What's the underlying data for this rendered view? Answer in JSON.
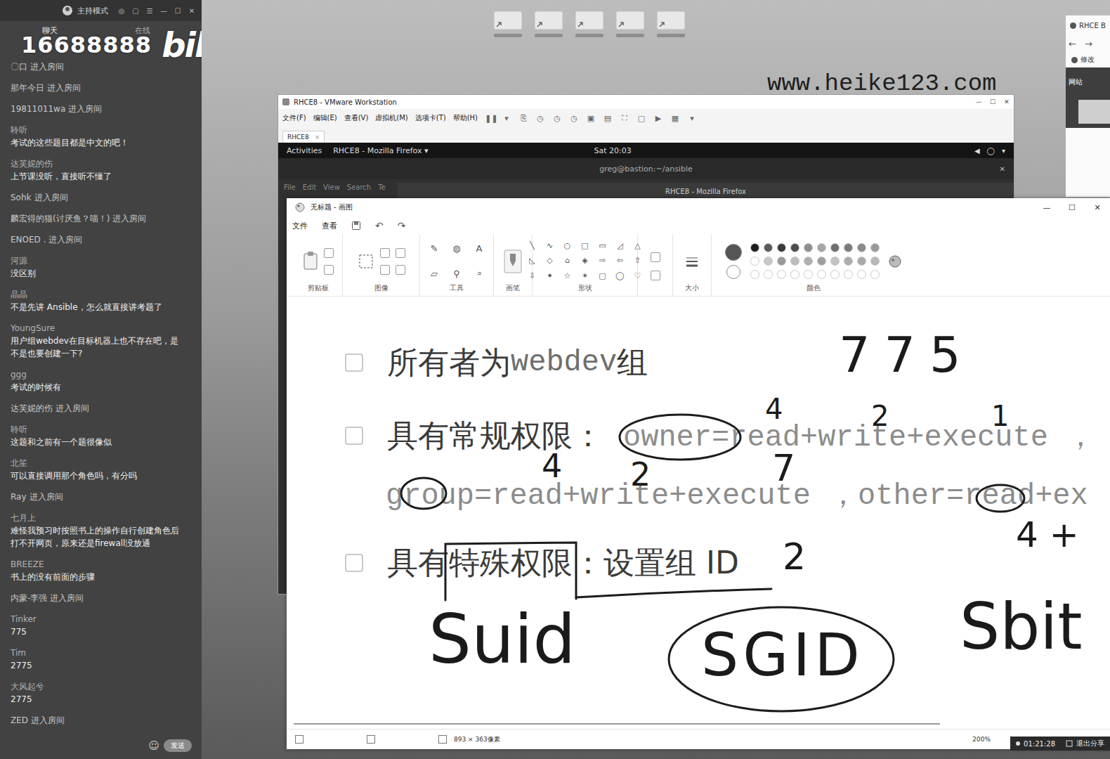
{
  "live_panel": {
    "mode": "主持模式",
    "controls": [
      "◎",
      "▢",
      "☰",
      "—",
      "☐",
      "✕"
    ],
    "tabs": [
      {
        "label": "聊天",
        "selected": true
      },
      {
        "label": "在线",
        "selected": false
      }
    ],
    "messages": [
      {
        "kind": "enter",
        "user": "〇口",
        "text": "进入房间"
      },
      {
        "kind": "enter",
        "user": "那年今日",
        "text": "进入房间"
      },
      {
        "kind": "enter",
        "user": "19811011wa",
        "text": "进入房间"
      },
      {
        "kind": "chat",
        "user": "聆听",
        "text": "考试的这些题目都是中文的吧！"
      },
      {
        "kind": "chat",
        "user": "达芙妮的伤",
        "text": "上节课没听，直接听不懂了"
      },
      {
        "kind": "enter",
        "user": "Sohk",
        "text": "进入房间"
      },
      {
        "kind": "enter",
        "user": "麟宏得的猫(讨厌鱼？喵！)",
        "text": "进入房间"
      },
      {
        "kind": "enter",
        "user": "ENOED .",
        "text": "进入房间"
      },
      {
        "kind": "chat",
        "user": "河源",
        "text": "没区别"
      },
      {
        "kind": "chat",
        "user": "晶晶",
        "text": "不是先讲 Ansible，怎么就直接讲考题了"
      },
      {
        "kind": "chat",
        "user": "YoungSure",
        "text": "用户组webdev在目标机器上也不存在吧，是不是也要创建一下?"
      },
      {
        "kind": "chat",
        "user": "ggg",
        "text": "考试的时候有"
      },
      {
        "kind": "enter",
        "user": "达芙妮的伤",
        "text": "进入房间"
      },
      {
        "kind": "chat",
        "user": "聆听",
        "text": "这题和之前有一个题很像似"
      },
      {
        "kind": "chat",
        "user": "北笙",
        "text": "可以直接调用那个角色吗，有分吗"
      },
      {
        "kind": "enter",
        "user": "Ray",
        "text": "进入房间"
      },
      {
        "kind": "chat",
        "user": "七月上",
        "text": "难怪我预习时按照书上的操作自行创建角色后打不开网页，原来还是firewall没放通"
      },
      {
        "kind": "chat",
        "user": "BREEZE",
        "text": "书上的没有前面的步骤"
      },
      {
        "kind": "enter",
        "user": "内蒙-李强",
        "text": "进入房间"
      },
      {
        "kind": "chat",
        "user": "Tinker",
        "text": "775"
      },
      {
        "kind": "chat",
        "user": "Tim",
        "text": "2775"
      },
      {
        "kind": "chat",
        "user": "大风起兮",
        "text": "2775"
      },
      {
        "kind": "enter",
        "user": "ZED",
        "text": "进入房间"
      }
    ],
    "emoji": "☺",
    "send": "发送"
  },
  "watermark": {
    "room": "16688888",
    "logo": "bilibili",
    "site": "www.heike123.com"
  },
  "desktop": {
    "shortcuts": [
      {
        "selected": false
      },
      {
        "selected": false
      },
      {
        "selected": false
      },
      {
        "selected": false
      },
      {
        "selected": false
      }
    ]
  },
  "browser": {
    "tab": "RHCE B",
    "nav": [
      "←",
      "→"
    ],
    "bookmark": "修改",
    "banner": "网站"
  },
  "vmware": {
    "title": "RHCE8 - VMware Workstation",
    "controls": [
      "—",
      "☐",
      "✕"
    ],
    "menu": [
      "文件(F)",
      "编辑(E)",
      "查看(V)",
      "虚拟机(M)",
      "选项卡(T)",
      "帮助(H)"
    ],
    "toolbar": [
      "❚❚",
      "▾",
      "⎘",
      "◷",
      "◷",
      "◷",
      "▣",
      "▤",
      "⛶",
      "▢",
      "▶",
      "▦",
      "▾"
    ],
    "tab": "RHCE8",
    "tab_close": "×",
    "guest": {
      "activities": "Activities",
      "app": "RHCE8 - Mozilla Firefox ▾",
      "clock": "Sat 20:03",
      "tray": [
        "◀",
        "◯",
        "▾"
      ],
      "terminal_title": "greg@bastion:~/ansible",
      "terminal_close": "✕",
      "terminal_menu": [
        "File",
        "Edit",
        "View",
        "Search",
        "Te"
      ],
      "firefox_title": "RHCE8 - Mozilla Firefox"
    }
  },
  "paint": {
    "title": "无标题 - 画图",
    "controls": [
      "—",
      "☐",
      "✕"
    ],
    "menu": [
      "文件",
      "查看"
    ],
    "quick": [
      "↶",
      "↷"
    ],
    "groups": [
      "剪贴板",
      "图像",
      "工具",
      "画笔",
      "形状",
      "大小",
      "颜色"
    ],
    "tools": [
      "✎",
      "◍",
      "A",
      "▱",
      "⚲",
      "⌕"
    ],
    "shapes": [
      "╲",
      "∿",
      "○",
      "□",
      "▭",
      "◿",
      "△",
      "◺",
      "◇",
      "⌂",
      "◈",
      "⇨",
      "⇦",
      "⇧",
      "⇩",
      "✦",
      "☆",
      "✶",
      "▢",
      "◯",
      "♡"
    ],
    "color1": "#555555",
    "color2": "#ffffff",
    "palette": [
      "#1e1e1e",
      "#5a5a5a",
      "#3a3a3a",
      "#4d4d4d",
      "#8f8f8f",
      "#a6a6a6",
      "#6e6e6e",
      "#7a7a7a",
      "#8a8a8a",
      "#999999",
      "#ffffff",
      "#c8c8c8",
      "#9a9a9a",
      "#bcbcbc",
      "#b0b0b0",
      "#9f9f9f",
      "#c3c3c3",
      "#adadad",
      "#a9a9a9",
      "#b8b8b8",
      "#ffffff",
      "#ffffff",
      "#ffffff",
      "#ffffff",
      "#ffffff",
      "#ffffff",
      "#ffffff",
      "#ffffff",
      "#ffffff",
      "#ffffff"
    ],
    "canvas": {
      "lines": [
        {
          "kind": "item",
          "checked": false,
          "parts": [
            {
              "kind": "cn",
              "text": "所有者为 "
            },
            {
              "kind": "code",
              "text": "webdev"
            },
            {
              "kind": "cn",
              "text": " 组"
            }
          ]
        },
        {
          "kind": "item",
          "checked": false,
          "parts": [
            {
              "kind": "cn",
              "text": "具有常规权限："
            },
            {
              "kind": "code",
              "text": "owner=read+write+execute ，"
            }
          ]
        },
        {
          "kind": "continuation",
          "checked": false,
          "parts": [
            {
              "kind": "code",
              "text": "group=read+write+execute ，other=read+ex"
            }
          ]
        },
        {
          "kind": "item",
          "checked": false,
          "parts": [
            {
              "kind": "cn",
              "text": "具有"
            },
            {
              "kind": "cn",
              "text": "特殊权限"
            },
            {
              "kind": "cn",
              "text": "：设置组 ID"
            }
          ]
        }
      ],
      "notes": [
        "775",
        "4",
        "2",
        "1",
        "4",
        "2",
        "7",
        "4 +",
        "2",
        "Suid",
        "SGID",
        "Sbit"
      ]
    },
    "status": {
      "size": "893 × 363像素",
      "zoom": "200%"
    }
  },
  "share_bar": {
    "time": "01:21:28",
    "button": "退出分享"
  }
}
